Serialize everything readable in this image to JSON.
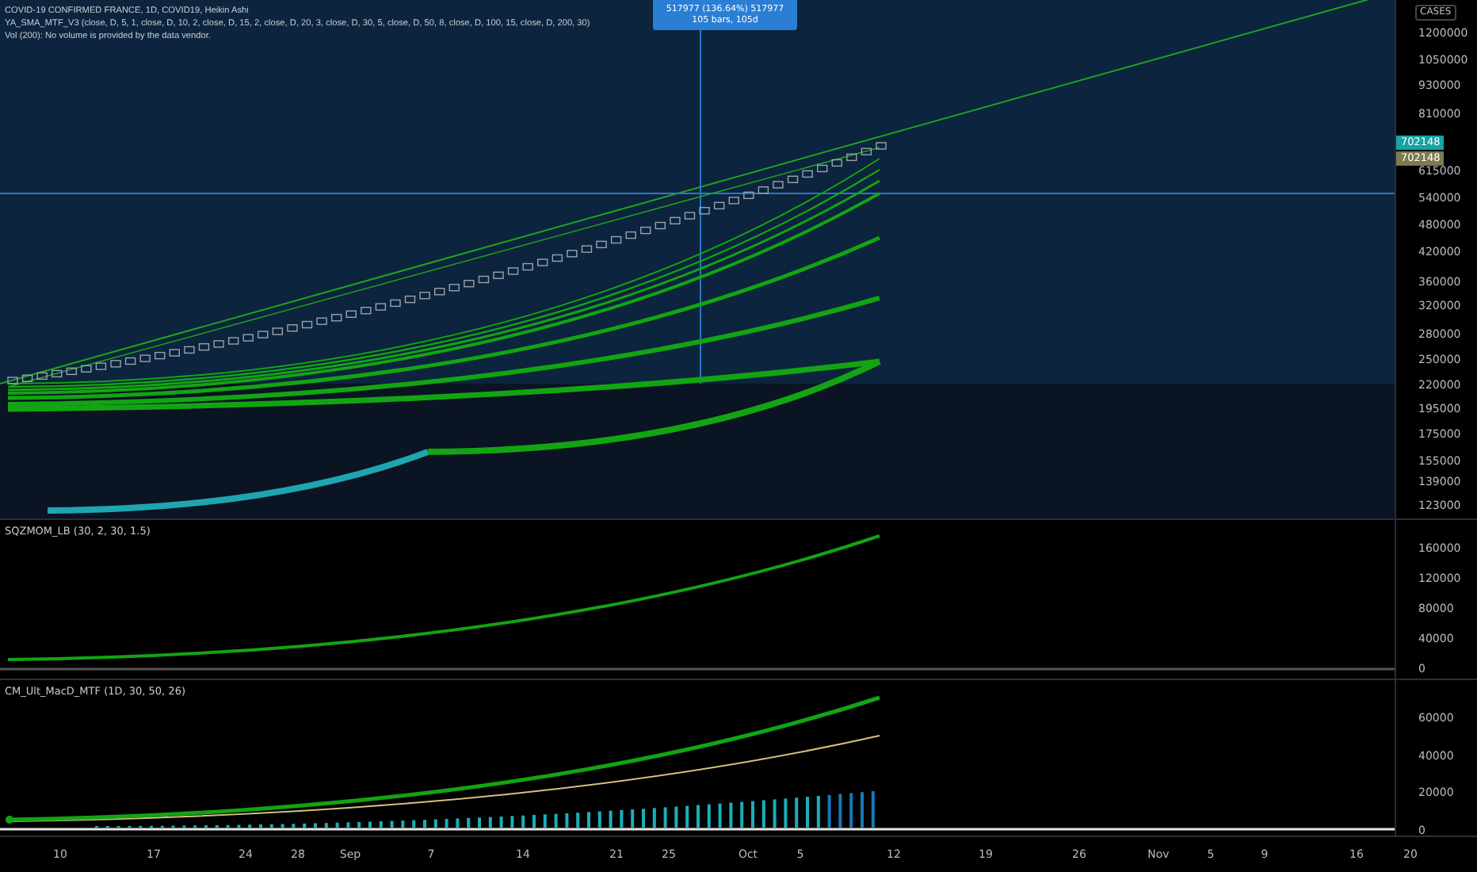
{
  "main_pane": {
    "legend": [
      "COVID-19 CONFIRMED FRANCE, 1D, COVID19, Heikin Ashi",
      "YA_SMA_MTF_V3 (close, D, 5, 1, close, D, 10, 2, close, D, 15, 2, close, D, 20, 3, close, D, 30, 5, close, D, 50, 8, close, D, 100, 15, close, D, 200, 30)",
      "Vol (200): No volume is provided by the data vendor."
    ],
    "measure_tooltip": [
      "517977 (136.64%) 517977",
      "105 bars, 105d"
    ],
    "price_axis": {
      "unit": "CASES",
      "labels": [
        "1200000",
        "1050000",
        "930000",
        "810000",
        "615000",
        "540000",
        "480000",
        "420000",
        "360000",
        "320000",
        "280000",
        "250000",
        "220000",
        "195000",
        "175000",
        "155000",
        "139000",
        "123000"
      ]
    },
    "price_badges": [
      {
        "text": "702148",
        "color": "#16a3a3"
      },
      {
        "text": "702148",
        "color": "#7d7a52"
      }
    ]
  },
  "indicator_panes": [
    {
      "title": "SQZMOM_LB (30, 2, 30, 1.5)",
      "axis_labels": [
        "160000",
        "120000",
        "80000",
        "40000",
        "0"
      ]
    },
    {
      "title": "CM_Ult_MacD_MTF (1D, 30, 50, 26)",
      "axis_labels": [
        "60000",
        "40000",
        "20000",
        "0"
      ]
    }
  ],
  "time_axis": [
    "10",
    "17",
    "24",
    "28",
    "Sep",
    "7",
    "14",
    "21",
    "25",
    "Oct",
    "5",
    "12",
    "19",
    "26",
    "Nov",
    "5",
    "9",
    "16",
    "20"
  ]
}
